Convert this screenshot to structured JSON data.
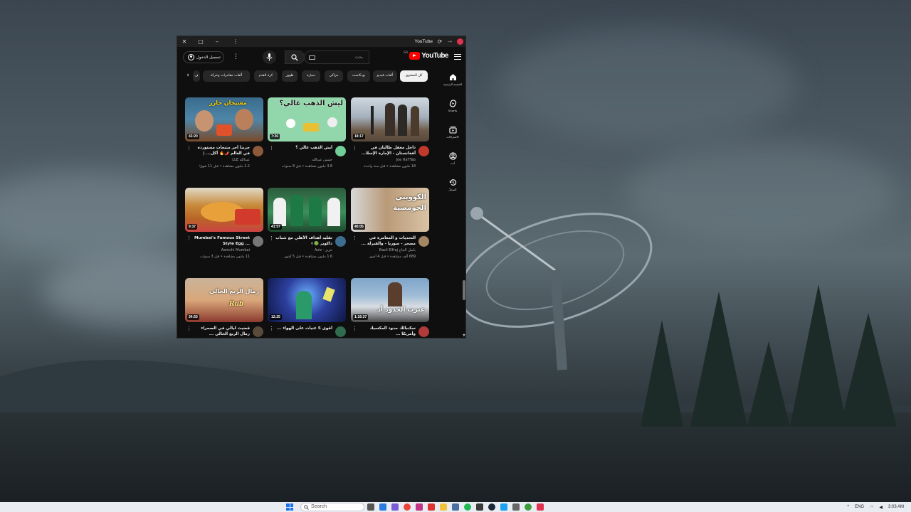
{
  "window": {
    "title": "YouTube"
  },
  "header": {
    "logo_text": "YouTube",
    "logo_country": "SA",
    "search_placeholder": "بحث",
    "sign_in_label": "تسجيل الدخول"
  },
  "sidebar": {
    "items": [
      {
        "label": "الصفحة الرئيسية",
        "icon": "home-icon"
      },
      {
        "label": "Shorts",
        "icon": "shorts-icon"
      },
      {
        "label": "الاشتراكات",
        "icon": "subscriptions-icon"
      },
      {
        "label": "أنت",
        "icon": "you-icon"
      },
      {
        "label": "السجلّ",
        "icon": "history-icon"
      }
    ]
  },
  "chips": [
    {
      "label": "كل المحتوى",
      "active": true
    },
    {
      "label": "ألعاب فيديو",
      "active": false
    },
    {
      "label": "بودكاست",
      "active": false
    },
    {
      "label": "مزاكي",
      "active": false
    },
    {
      "label": "سيارة",
      "active": false
    },
    {
      "label": "ظهور",
      "active": false
    },
    {
      "label": "كرة القدم",
      "active": false
    },
    {
      "label": "ألعاب مغامرات وحركة",
      "active": false
    },
    {
      "label": "ف",
      "active": false
    }
  ],
  "videos": [
    {
      "title": "داخل معقل طالبان في أفغانستان - الإمارة الإسلا...",
      "channel": "Joe HaTTab",
      "stats": "18 مليون مشاهدة • قبل سنة واحدة",
      "duration": "18:17",
      "overlay": "",
      "thumb_color": "#a9b6c4",
      "avatar_color": "#c0392b"
    },
    {
      "title": "أيش الذهب غالي ؟",
      "channel": "حسين عبدالله",
      "stats": "3.8 مليون مشاهدة • قبل 8 سنوات",
      "duration": "7:26",
      "overlay": "ليش الذهب غالي؟",
      "thumb_color": "#8fd3a8",
      "avatar_color": "#6fcf97"
    },
    {
      "title": "جربنا أحر منتجات مستوردة في العالم 🌶️🔥 أكل... | فاجب...",
      "channel": "LLE عبدالله",
      "stats": "2.2 مليون مشاهدة • قبل 11 شهرًا",
      "duration": "43:20",
      "overlay": "مشيخان حارر",
      "thumb_color": "#3e6f8e",
      "avatar_color": "#8e5a3c"
    },
    {
      "title": "التحديات و المغامرة في مصحر - سوريا - والقبرلة ...",
      "channel": "Basil ElHaj باسل الحاج",
      "stats": "689 ألف مشاهدة • قبل 4 أشهر",
      "duration": "40:05",
      "overlay": "الكوويبي الحومصية",
      "thumb_color": "#c2a482",
      "avatar_color": "#a38664"
    },
    {
      "title": "تقليد أهداف الأهلي مع شباب داكوبز 🟢⚪",
      "channel": "Aziz - عزيز",
      "stats": "1.6 مليون مشاهدة • قبل 5 أشهر",
      "duration": "41:57",
      "overlay": "",
      "thumb_color": "#2e7d4f",
      "avatar_color": "#3d6e8f"
    },
    {
      "title": "Mumbai's Famous Street Style Egg ...",
      "channel": "Aamchi Mumbai",
      "stats": "11 مليون مشاهدة • قبل 3 سنوات",
      "duration": "9:37",
      "overlay": "",
      "thumb_color": "#c68a3a",
      "avatar_color": "#777"
    },
    {
      "title": "سكنبالك حدود المكسيك وأمريكا ...",
      "channel": "",
      "stats": "",
      "duration": "1:16:37",
      "overlay": "عبرت الحدود أد",
      "thumb_color": "#6b8fb3",
      "avatar_color": "#b13b3b"
    },
    {
      "title": "أقوى 5 غنيات على الهواء ...",
      "channel": "",
      "stats": "",
      "duration": "12:25",
      "overlay": "",
      "thumb_color": "#1b2a6b",
      "avatar_color": "#2f6b4f"
    },
    {
      "title": "قضيت ليالي في الصحراء رمال الربع الخالي ...",
      "channel": "",
      "stats": "",
      "duration": "34:53",
      "overlay": "رمال الربع الخالي",
      "thumb_color": "#caa27a",
      "avatar_color": "#5a4a3a"
    }
  ],
  "taskbar": {
    "search_placeholder": "Search",
    "language": "ENG",
    "time": "3:03 AM"
  },
  "colors": {
    "yt_bg": "#0f0f0f",
    "brand_red": "#ff0000",
    "chip_bg": "#272727"
  }
}
